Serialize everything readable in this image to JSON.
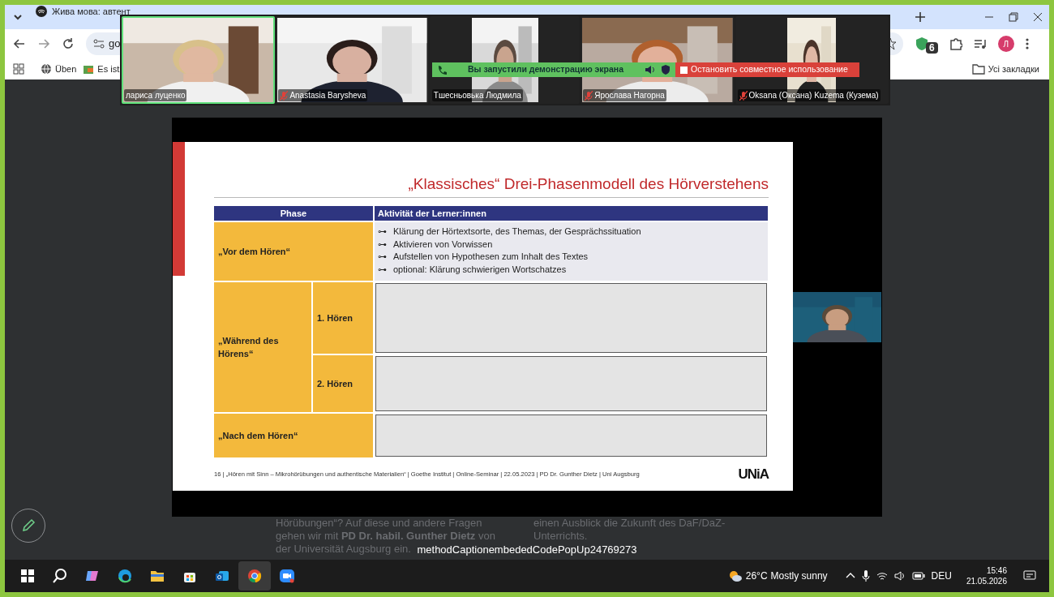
{
  "browser": {
    "tabs": [
      {
        "label": "Жива мова: автент",
        "selected": false
      }
    ],
    "address": "go",
    "extension_badge": "6",
    "profile_initial": "Л",
    "bookmarks": [
      {
        "label": "Üben"
      },
      {
        "label": "Es ist"
      }
    ],
    "all_bookmarks": "Усі закладки"
  },
  "meeting": {
    "participants": [
      {
        "name": "лариса луценко",
        "muted": false,
        "speaking": true
      },
      {
        "name": "Anastasia Barysheva",
        "muted": true,
        "speaking": false
      },
      {
        "name": "Тшесньовька Людмила",
        "muted": false,
        "speaking": false
      },
      {
        "name": "Ярослава Нагорна",
        "muted": true,
        "speaking": false
      },
      {
        "name": "Oksana  (Оксана) Kuzema (Кузема)",
        "muted": true,
        "speaking": false
      }
    ],
    "share_status": "Вы запустили демонстрацию экрана",
    "stop_share": "Остановить совместное использование"
  },
  "slide": {
    "title": "„Klassisches“ Drei-Phasenmodell des Hörverstehens",
    "columns": [
      "Phase",
      "Aktivität der Lerner:innen"
    ],
    "phases": [
      {
        "kind": "list",
        "label": "„Vor dem Hören“",
        "activities": [
          {
            "bullet": "⊶",
            "text": "Klärung der Hörtextsorte, des Themas, der Gesprächssituation"
          },
          {
            "bullet": "⊶",
            "text": "Aktivieren von Vorwissen"
          },
          {
            "bullet": "⊶",
            "text": "Aufstellen von Hypothesen zum Inhalt des Textes"
          },
          {
            "bullet": "⊶",
            "text": "optional: Klärung schwierigen Wortschatzes"
          }
        ]
      },
      {
        "kind": "split",
        "label": "„Während des Hörens“",
        "subphases": [
          "1. Hören",
          "2. Hören"
        ]
      },
      {
        "kind": "blank",
        "label": "„Nach dem Hören“"
      }
    ],
    "footer": "16 |   „Hören mit Sinn – Mikrohörübungen und authentische Materialien“ | Goethe Institut | Online-Seminar | 22.05.2023 |  PD Dr. Gunther Dietz | Uni Augsburg",
    "logo": "UNiA"
  },
  "page_behind": {
    "left": [
      "Hörübungen“? Auf diese und andere Fragen",
      "gehen wir mit **PD Dr. habil. Gunther Dietz** von",
      "der Universität Augsburg ein."
    ],
    "right": [
      "einen Ausblick die Zukunft des DaF/DaZ-",
      "Unterrichts."
    ]
  },
  "caption": "methodCaptionembededCodePopUp24769273",
  "taskbar": {
    "apps": [
      {
        "kind": "start",
        "selected": false
      },
      {
        "kind": "search",
        "selected": false
      },
      {
        "kind": "copilot",
        "selected": false
      },
      {
        "kind": "edge",
        "selected": false
      },
      {
        "kind": "files",
        "selected": false
      },
      {
        "kind": "store",
        "selected": false
      },
      {
        "kind": "outlook",
        "selected": false
      },
      {
        "kind": "chrome",
        "selected": true
      },
      {
        "kind": "zoom",
        "selected": false
      }
    ],
    "temperature": "26°C",
    "weather": "Mostly sunny",
    "language": "DEU",
    "time": "15:46",
    "date": "21.05.2026"
  }
}
